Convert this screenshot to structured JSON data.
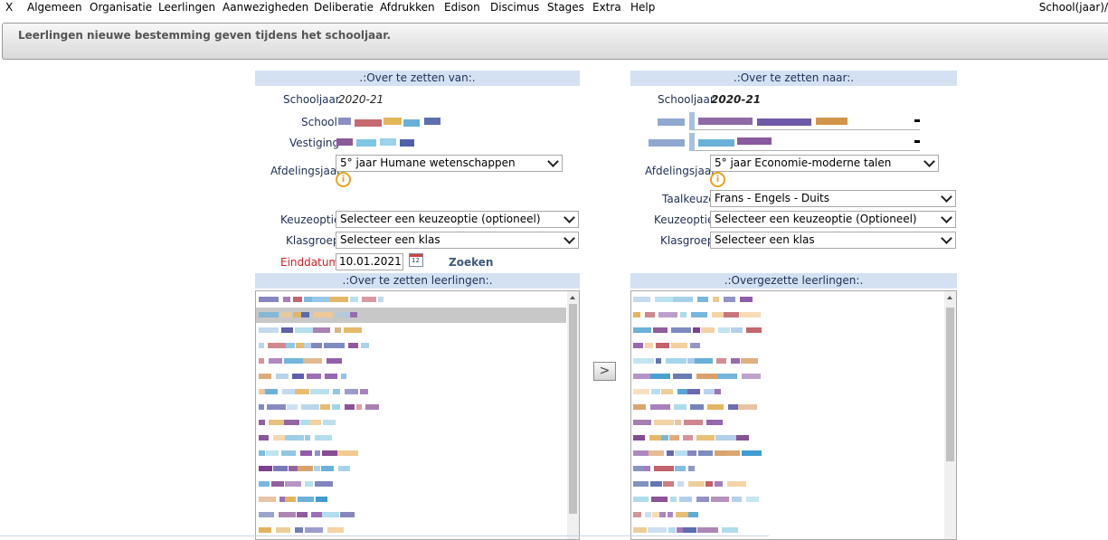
{
  "menu": {
    "items": [
      "X",
      "Algemeen",
      "Organisatie",
      "Leerlingen",
      "Aanwezigheden",
      "Deliberatie",
      "Afdrukken",
      "Edison",
      "Discimus",
      "Stages",
      "Extra",
      "Help"
    ],
    "right": "School(jaar)/"
  },
  "page_title": "Leerlingen nieuwe bestemming geven tijdens het schooljaar.",
  "from": {
    "header": ".:Over te zetten van:.",
    "schooljaar_label": "Schooljaar",
    "schooljaar_value": "2020-21",
    "school_label": "School",
    "vestiging_label": "Vestiging",
    "afdelingsjaar_label": "Afdelingsjaar",
    "afdelingsjaar_value": "5° jaar Humane wetenschappen",
    "keuzeoptie_label": "Keuzeoptie",
    "keuzeoptie_value": "Selecteer een keuzeoptie (optioneel)",
    "klasgroep_label": "Klasgroep",
    "klasgroep_value": "Selecteer een klas",
    "einddatum_label": "Einddatum",
    "einddatum_value": "10.01.2021",
    "calendar_num": "12",
    "zoeken_label": "Zoeken"
  },
  "to": {
    "header": ".:Over te zetten naar:.",
    "schooljaar_label": "Schooljaar",
    "schooljaar_value": "2020-21",
    "afdelingsjaar_label": "Afdelingsjaar",
    "afdelingsjaar_value": "5° jaar Economie-moderne talen",
    "taalkeuze_label": "Taalkeuze",
    "taalkeuze_value": "Frans - Engels - Duits",
    "keuzeoptie_label": "Keuzeoptie",
    "keuzeoptie_value": "Selecteer een keuzeoptie (Optioneel)",
    "klasgroep_label": "Klasgroep",
    "klasgroep_value": "Selecteer een klas"
  },
  "lists": {
    "source_header": ".:Over te zetten leerlingen:.",
    "target_header": ".:Overgezette leerlingen:.",
    "move_button": ">"
  },
  "colors": {
    "section_header_bg": "#d3e1f2",
    "label_text": "#1f2f55",
    "einddatum_label": "#d0202a",
    "info_icon": "#e8a320"
  },
  "icons": {
    "info": "info-circle-icon",
    "calendar": "calendar-icon",
    "dropdown": "chevron-down-icon"
  }
}
